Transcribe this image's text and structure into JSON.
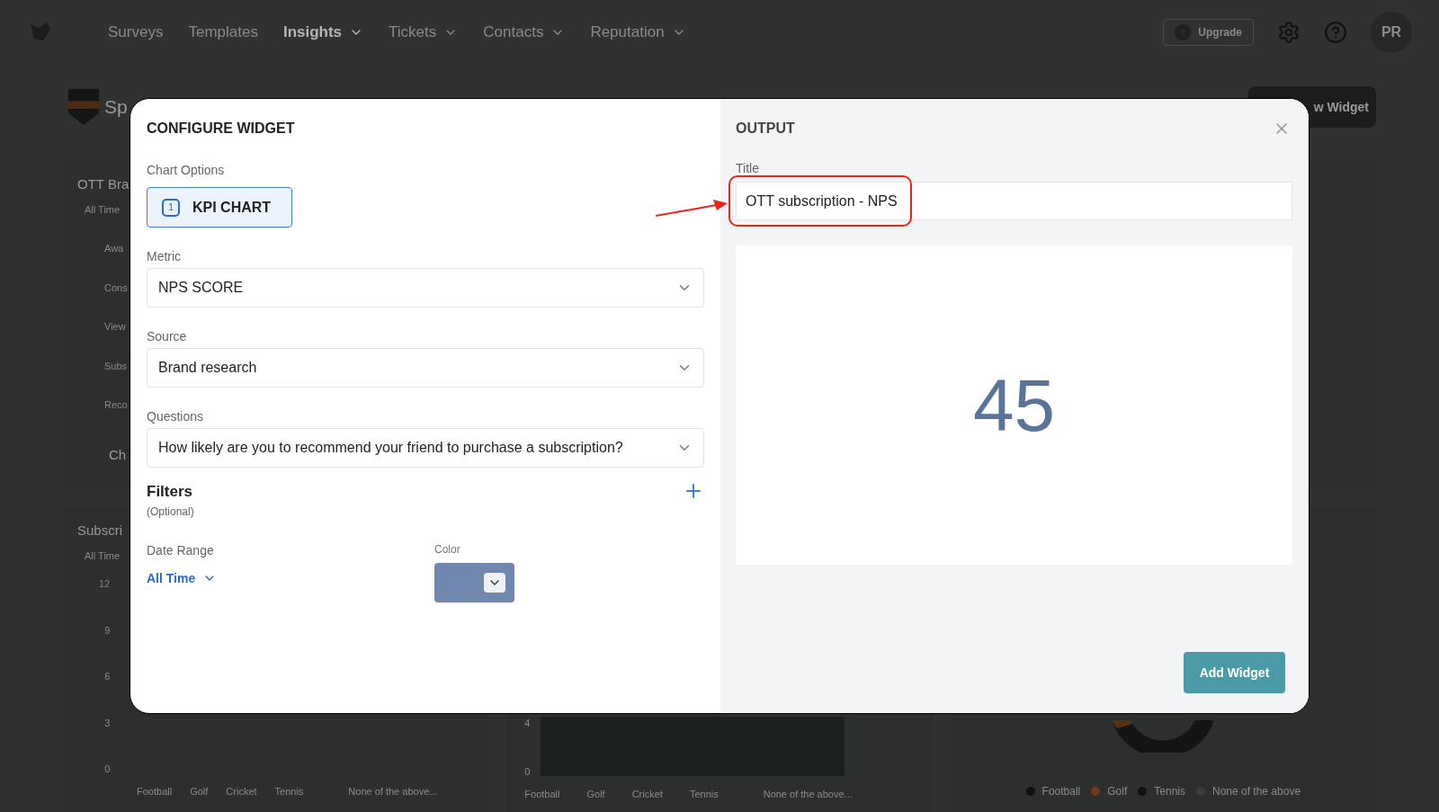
{
  "nav": {
    "items": [
      {
        "label": "Surveys",
        "selected": false,
        "dropdown": false
      },
      {
        "label": "Templates",
        "selected": false,
        "dropdown": false
      },
      {
        "label": "Insights",
        "selected": true,
        "dropdown": true
      },
      {
        "label": "Tickets",
        "selected": false,
        "dropdown": true
      },
      {
        "label": "Contacts",
        "selected": false,
        "dropdown": true
      },
      {
        "label": "Reputation",
        "selected": false,
        "dropdown": true
      }
    ],
    "upgrade": "Upgrade",
    "avatar": "PR"
  },
  "page": {
    "title": "Sp",
    "add_widget": "w Widget"
  },
  "background_cards": [
    {
      "title": "OTT Bra",
      "range": "All Time",
      "rows": [
        "Awa",
        "Cons",
        "View",
        "Subs",
        "Reco"
      ],
      "footer": "Ch"
    },
    {
      "title": "Subscri",
      "range": "All Time",
      "yticks": [
        "12",
        "9",
        "6",
        "3",
        "0"
      ],
      "xlabels": [
        "Football",
        "Golf",
        "Cricket",
        "Tennis",
        "None of the above..."
      ]
    }
  ],
  "background_middle": {
    "yticks": [
      "4",
      "0"
    ],
    "xlabels": [
      "Football",
      "Golf",
      "Cricket",
      "Tennis",
      "None of the above..."
    ]
  },
  "background_right": {
    "legend": [
      {
        "label": "Football",
        "color": "#111111"
      },
      {
        "label": "Golf",
        "color": "#6b3d1c"
      },
      {
        "label": "Tennis",
        "color": "#111111"
      },
      {
        "label": "None of the above",
        "color": "#3c3c3c"
      }
    ]
  },
  "modal": {
    "title": "CONFIGURE WIDGET",
    "chart_options": {
      "label": "Chart Options",
      "items": [
        {
          "label": "KPI CHART",
          "number": "1",
          "selected": true
        }
      ]
    },
    "selects": [
      {
        "label": "Metric",
        "value": "NPS SCORE"
      },
      {
        "label": "Source",
        "value": "Brand research"
      },
      {
        "label": "Questions",
        "value": "How likely are you to recommend your friend to purchase a subscription?"
      }
    ],
    "filters": {
      "title": "Filters",
      "note": "(Optional)"
    },
    "date_range": {
      "label": "Date Range",
      "value": "All Time"
    },
    "color_picker": {
      "label": "Color"
    },
    "output": {
      "title": "OUTPUT",
      "title_label": "Title",
      "title_value": "OTT subscription - NPS",
      "highlighted": true,
      "kpi": "45",
      "button": "Add Widget"
    }
  }
}
